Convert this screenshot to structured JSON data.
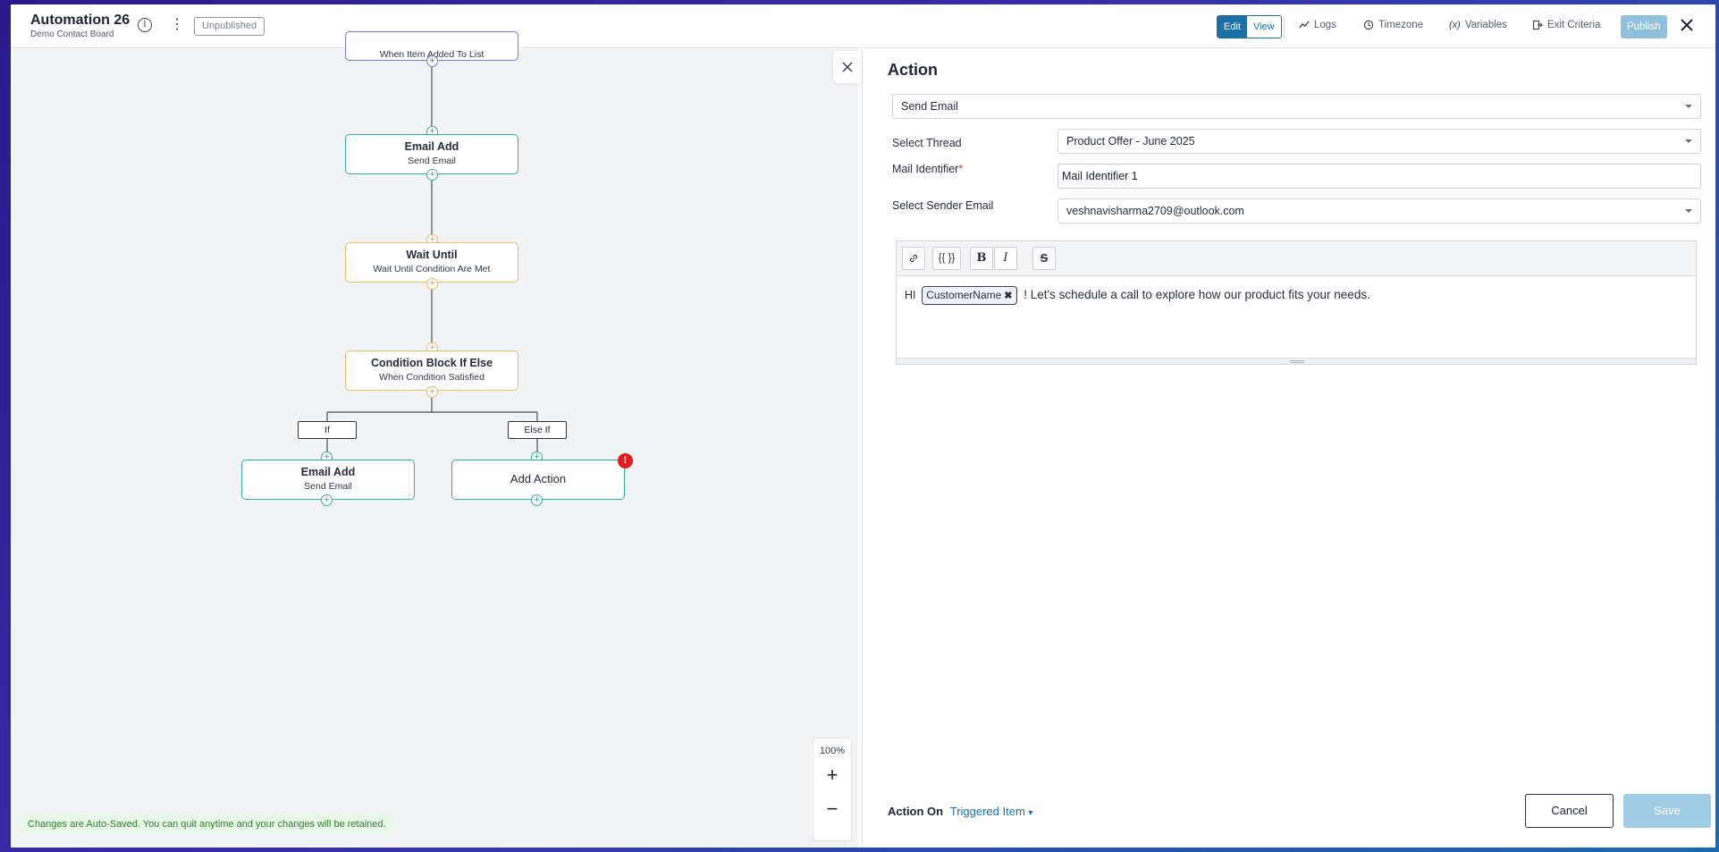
{
  "header": {
    "title": "Automation 26",
    "subtitle": "Demo Contact Board",
    "status": "Unpublished",
    "mode_edit": "Edit",
    "mode_view": "View",
    "logs": "Logs",
    "timezone": "Timezone",
    "variables": "Variables",
    "exit_criteria": "Exit Criteria",
    "publish": "Publish"
  },
  "canvas": {
    "trigger_node": {
      "sub": "When Item Added To List"
    },
    "nodes": [
      {
        "title": "Email Add",
        "sub": "Send Email"
      },
      {
        "title": "Wait Until",
        "sub": "Wait Until Condition Are Met"
      },
      {
        "title": "Condition Block If Else",
        "sub": "When Condition Satisfied"
      },
      {
        "title": "Email Add",
        "sub": "Send Email"
      },
      {
        "title": "Add Action"
      }
    ],
    "branch_if": "If",
    "branch_else_if": "Else If",
    "error_mark": "!",
    "zoom_level": "100%",
    "zoom_in": "+",
    "zoom_out": "−",
    "autosave_note": "Changes are Auto-Saved. You can quit anytime and your changes will be retained."
  },
  "panel": {
    "title": "Action",
    "action_type": "Send Email",
    "thread_label": "Select Thread",
    "thread_value": "Product Offer - June 2025",
    "identifier_label": "Mail Identifier",
    "identifier_required": "*",
    "identifier_value": "Mail Identifier 1",
    "sender_label": "Select Sender Email",
    "sender_value": "veshnavisharma2709@outlook.com",
    "toolbar": {
      "variables": "{{ }}",
      "bold": "B",
      "italic": "I",
      "strike": "S"
    },
    "body_prefix": "HI",
    "body_chip": "CustomerName",
    "body_suffix": "! Let's schedule a call to explore how our product fits your needs.",
    "action_on_label": "Action On",
    "action_on_value": "Triggered Item",
    "cancel": "Cancel",
    "save": "Save"
  },
  "colors": {
    "accent": "#1d6fa8",
    "email_node_border": "#2fb39c",
    "wait_node_border": "#f2b86a",
    "error": "#e21d1d"
  }
}
